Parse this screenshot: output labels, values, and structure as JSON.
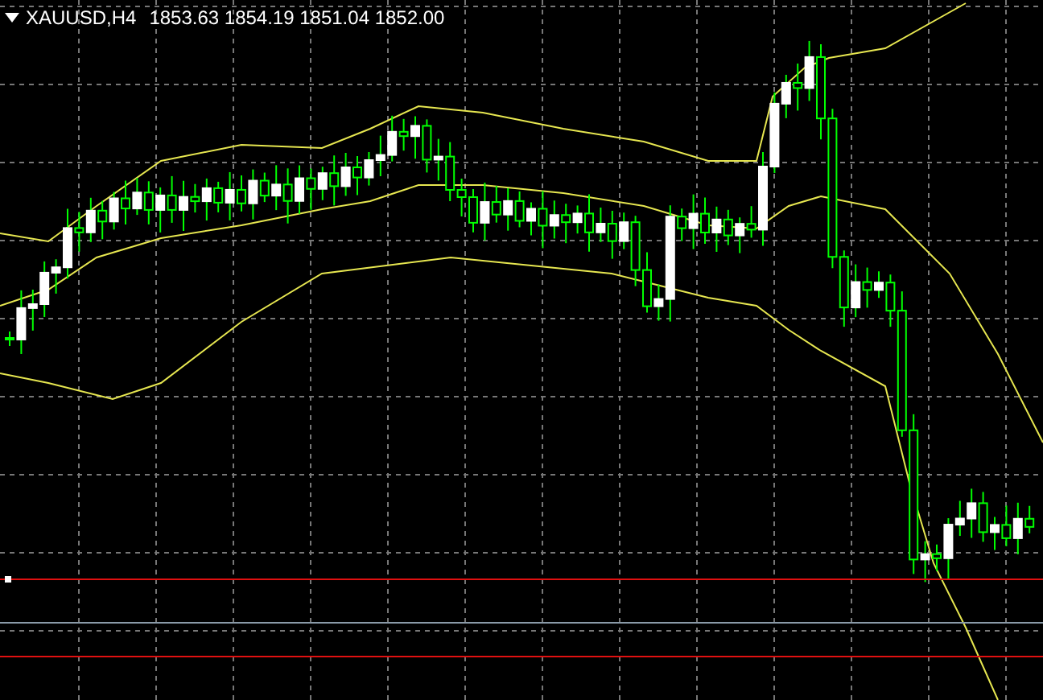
{
  "chart": {
    "symbol": "XAUUSD,H4",
    "ohlc": "1853.63 1854.19 1851.04 1852.00"
  }
}
